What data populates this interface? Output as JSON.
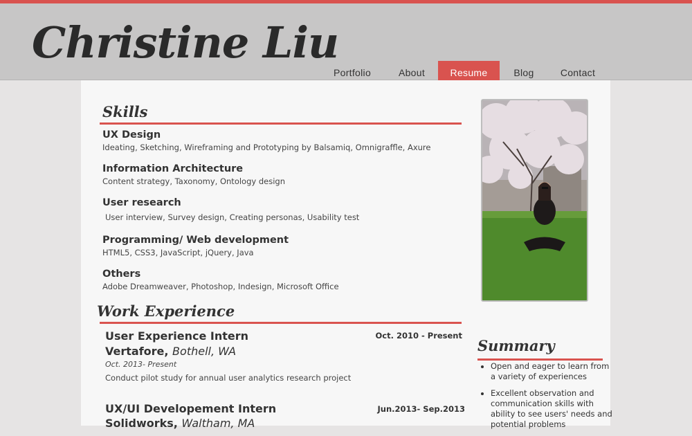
{
  "site": {
    "name": "Christine Liu"
  },
  "nav": {
    "items": [
      "Portfolio",
      "About",
      "Resume",
      "Blog",
      "Contact"
    ],
    "active": "Resume"
  },
  "colors": {
    "accent": "#d9534f",
    "header_bg": "#c7c6c6",
    "page_bg": "#e6e4e4",
    "content_bg": "#f7f7f7"
  },
  "skills": {
    "title": "Skills",
    "items": [
      {
        "heading": "UX Design",
        "desc": "Ideating, Sketching, Wireframing and Prototyping by Balsamiq, Omnigraffle, Axure"
      },
      {
        "heading": "Information Architecture",
        "desc": "Content strategy, Taxonomy, Ontology design"
      },
      {
        "heading": "User research",
        "desc": "User interview, Survey design, Creating personas, Usability test"
      },
      {
        "heading": "Programming/ Web development",
        "desc": "HTML5, CSS3, JavaScript, jQuery, Java"
      },
      {
        "heading": "Others",
        "desc": "Adobe Dreamweaver, Photoshop, Indesign, Microsoft Office"
      }
    ]
  },
  "work": {
    "title": "Work Experience",
    "jobs": [
      {
        "title": "User Experience Intern",
        "date": "Oct. 2010 - Present",
        "company": "Vertafore,",
        "location": "Bothell, WA",
        "period": "Oct. 2013- Present",
        "desc": "Conduct pilot study for annual user analytics research project"
      },
      {
        "title": "UX/UI Developement Intern",
        "date": "Jun.2013- Sep.2013",
        "company": "Solidworks,",
        "location": "Waltham, MA"
      }
    ]
  },
  "summary": {
    "title": "Summary",
    "items": [
      "Open and eager to learn from a variety of experiences",
      "Excellent observation and communication skills with ability to see users' needs and potential problems"
    ]
  },
  "photo": {
    "icon": "profile-photo"
  }
}
